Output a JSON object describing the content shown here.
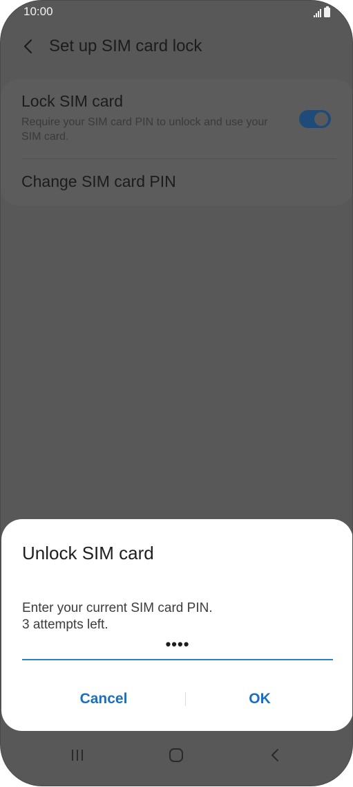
{
  "status_bar": {
    "time": "10:00",
    "icons": [
      "signal-icon",
      "battery-icon"
    ]
  },
  "header": {
    "back_icon": "back-arrow-icon",
    "title": "Set up SIM card lock"
  },
  "settings": {
    "lock_sim": {
      "title": "Lock SIM card",
      "subtitle": "Require your SIM card PIN to unlock and use your SIM card.",
      "toggle_on": true
    },
    "change_pin": {
      "title": "Change SIM card PIN"
    }
  },
  "dialog": {
    "title": "Unlock SIM card",
    "message_line1": "Enter your current SIM card PIN.",
    "message_line2": "3 attempts left.",
    "pin_value": "••••",
    "cancel_label": "Cancel",
    "ok_label": "OK"
  },
  "nav_bar": {
    "icons": [
      "recent-apps-icon",
      "home-icon",
      "back-icon"
    ]
  },
  "colors": {
    "accent": "#1a6fc0",
    "underline": "#2f7fc1",
    "scrim": "#585858",
    "toggle": "#1f4b7a"
  }
}
